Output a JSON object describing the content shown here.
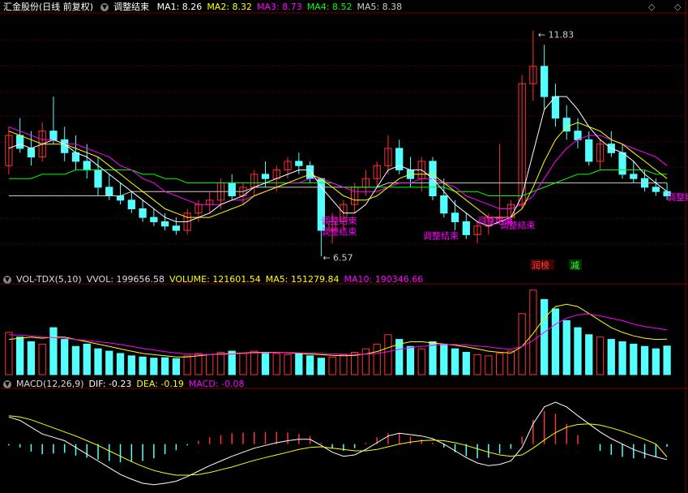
{
  "header": {
    "stock_name": "汇金股份(日线 前复权)",
    "indicator_name": "调整结束",
    "ma": [
      {
        "label": "MA1: 8.26",
        "color": "#ffffff"
      },
      {
        "label": "MA2: 8.32",
        "color": "#ffff00"
      },
      {
        "label": "MA3: 8.73",
        "color": "#ff00ff"
      },
      {
        "label": "MA4: 8.52",
        "color": "#00ff00"
      },
      {
        "label": "MA5: 8.38",
        "color": "#cccccc"
      }
    ],
    "nav_left": "◇",
    "nav_right": "◇"
  },
  "vol_header": {
    "name": "VOL-TDX(5,10)",
    "vvol": "VVOL: 199656.58",
    "volume": "VOLUME: 121601.54",
    "ma5": "MA5: 151279.84",
    "ma10": "MA10: 190346.66"
  },
  "macd_header": {
    "name": "MACD(12,26,9)",
    "dif": "DIF: -0.23",
    "dea": "DEA: -0.19",
    "macd": "MACD: -0.08"
  },
  "colors": {
    "up": "#ff3232",
    "down": "#54ffff",
    "ma1": "#ffffff",
    "ma2": "#ffff00",
    "ma3": "#ff00ff",
    "ma4": "#00ff00",
    "ma5": "#cccccc",
    "signal": "#ff00ff",
    "grid": "#7a0000"
  },
  "chart_data": {
    "type": "candlestick",
    "high_label": "11.83",
    "low_label": "6.57",
    "signals": [
      "调整结束",
      "调整结束",
      "调整结束",
      "调整结束",
      "调整结束",
      "调整结束"
    ],
    "tags": [
      "润榜",
      "减"
    ],
    "price": {
      "ylim": [
        6.3,
        12.2
      ],
      "candles": [
        {
          "o": 8.7,
          "h": 9.6,
          "l": 8.5,
          "c": 9.4
        },
        {
          "o": 9.4,
          "h": 9.8,
          "l": 9.0,
          "c": 9.1
        },
        {
          "o": 9.1,
          "h": 9.5,
          "l": 8.7,
          "c": 8.9
        },
        {
          "o": 8.9,
          "h": 9.7,
          "l": 8.8,
          "c": 9.5
        },
        {
          "o": 9.5,
          "h": 10.3,
          "l": 9.2,
          "c": 9.3
        },
        {
          "o": 9.3,
          "h": 9.6,
          "l": 8.8,
          "c": 9.0
        },
        {
          "o": 9.0,
          "h": 9.4,
          "l": 8.6,
          "c": 8.8
        },
        {
          "o": 8.8,
          "h": 9.2,
          "l": 8.4,
          "c": 8.6
        },
        {
          "o": 8.6,
          "h": 8.9,
          "l": 8.0,
          "c": 8.2
        },
        {
          "o": 8.2,
          "h": 8.5,
          "l": 7.9,
          "c": 8.0
        },
        {
          "o": 8.0,
          "h": 8.3,
          "l": 7.8,
          "c": 7.9
        },
        {
          "o": 7.9,
          "h": 8.1,
          "l": 7.6,
          "c": 7.7
        },
        {
          "o": 7.7,
          "h": 7.9,
          "l": 7.4,
          "c": 7.5
        },
        {
          "o": 7.5,
          "h": 7.7,
          "l": 7.3,
          "c": 7.4
        },
        {
          "o": 7.4,
          "h": 7.6,
          "l": 7.2,
          "c": 7.3
        },
        {
          "o": 7.3,
          "h": 7.5,
          "l": 7.1,
          "c": 7.2
        },
        {
          "o": 7.2,
          "h": 7.7,
          "l": 7.1,
          "c": 7.6
        },
        {
          "o": 7.6,
          "h": 7.9,
          "l": 7.4,
          "c": 7.8
        },
        {
          "o": 7.8,
          "h": 8.1,
          "l": 7.6,
          "c": 7.9
        },
        {
          "o": 7.9,
          "h": 8.4,
          "l": 7.7,
          "c": 8.3
        },
        {
          "o": 8.3,
          "h": 8.5,
          "l": 7.9,
          "c": 8.0
        },
        {
          "o": 8.0,
          "h": 8.3,
          "l": 7.8,
          "c": 8.2
        },
        {
          "o": 8.2,
          "h": 8.6,
          "l": 8.0,
          "c": 8.5
        },
        {
          "o": 8.5,
          "h": 8.8,
          "l": 8.2,
          "c": 8.4
        },
        {
          "o": 8.4,
          "h": 8.7,
          "l": 8.1,
          "c": 8.6
        },
        {
          "o": 8.6,
          "h": 8.9,
          "l": 8.4,
          "c": 8.8
        },
        {
          "o": 8.8,
          "h": 9.0,
          "l": 8.5,
          "c": 8.7
        },
        {
          "o": 8.7,
          "h": 8.8,
          "l": 8.3,
          "c": 8.4
        },
        {
          "o": 8.4,
          "h": 7.5,
          "l": 6.6,
          "c": 7.2
        },
        {
          "o": 7.2,
          "h": 7.6,
          "l": 6.9,
          "c": 7.4
        },
        {
          "o": 7.4,
          "h": 7.9,
          "l": 7.2,
          "c": 7.8
        },
        {
          "o": 7.8,
          "h": 8.3,
          "l": 7.6,
          "c": 8.2
        },
        {
          "o": 8.2,
          "h": 8.6,
          "l": 8.0,
          "c": 8.4
        },
        {
          "o": 8.4,
          "h": 8.8,
          "l": 8.2,
          "c": 8.7
        },
        {
          "o": 8.7,
          "h": 9.4,
          "l": 8.5,
          "c": 9.1
        },
        {
          "o": 9.1,
          "h": 9.3,
          "l": 8.5,
          "c": 8.6
        },
        {
          "o": 8.6,
          "h": 8.9,
          "l": 8.2,
          "c": 8.4
        },
        {
          "o": 8.4,
          "h": 8.9,
          "l": 8.1,
          "c": 8.8
        },
        {
          "o": 8.8,
          "h": 8.9,
          "l": 7.9,
          "c": 8.0
        },
        {
          "o": 8.0,
          "h": 8.4,
          "l": 7.5,
          "c": 7.6
        },
        {
          "o": 7.6,
          "h": 7.9,
          "l": 7.2,
          "c": 7.4
        },
        {
          "o": 7.4,
          "h": 7.6,
          "l": 7.0,
          "c": 7.1
        },
        {
          "o": 7.1,
          "h": 7.4,
          "l": 6.9,
          "c": 7.3
        },
        {
          "o": 7.3,
          "h": 7.6,
          "l": 7.1,
          "c": 7.5
        },
        {
          "o": 7.5,
          "h": 9.2,
          "l": 7.4,
          "c": 7.5
        },
        {
          "o": 7.5,
          "h": 7.9,
          "l": 7.3,
          "c": 7.8
        },
        {
          "o": 7.8,
          "h": 10.8,
          "l": 7.7,
          "c": 10.6
        },
        {
          "o": 10.6,
          "h": 11.83,
          "l": 10.2,
          "c": 11.0
        },
        {
          "o": 11.0,
          "h": 11.5,
          "l": 10.0,
          "c": 10.3
        },
        {
          "o": 10.3,
          "h": 10.6,
          "l": 9.6,
          "c": 9.8
        },
        {
          "o": 9.8,
          "h": 10.1,
          "l": 9.3,
          "c": 9.5
        },
        {
          "o": 9.5,
          "h": 9.8,
          "l": 9.1,
          "c": 9.3
        },
        {
          "o": 9.3,
          "h": 9.5,
          "l": 8.7,
          "c": 8.8
        },
        {
          "o": 8.8,
          "h": 9.3,
          "l": 8.6,
          "c": 9.2
        },
        {
          "o": 9.2,
          "h": 9.5,
          "l": 8.9,
          "c": 9.0
        },
        {
          "o": 9.0,
          "h": 9.2,
          "l": 8.4,
          "c": 8.5
        },
        {
          "o": 8.5,
          "h": 8.8,
          "l": 8.3,
          "c": 8.4
        },
        {
          "o": 8.4,
          "h": 8.6,
          "l": 8.1,
          "c": 8.2
        },
        {
          "o": 8.2,
          "h": 8.4,
          "l": 8.0,
          "c": 8.1
        },
        {
          "o": 8.1,
          "h": 8.3,
          "l": 7.9,
          "c": 8.0
        }
      ],
      "ma1": [
        9.1,
        9.2,
        9.1,
        9.2,
        9.3,
        9.2,
        9.0,
        8.9,
        8.7,
        8.5,
        8.3,
        8.1,
        7.9,
        7.7,
        7.5,
        7.4,
        7.4,
        7.5,
        7.6,
        7.8,
        7.9,
        8.0,
        8.2,
        8.3,
        8.4,
        8.5,
        8.6,
        8.6,
        8.2,
        7.9,
        7.6,
        7.6,
        7.8,
        8.2,
        8.6,
        8.7,
        8.6,
        8.6,
        8.4,
        8.1,
        7.8,
        7.6,
        7.4,
        7.3,
        7.4,
        7.5,
        8.0,
        9.0,
        10.0,
        10.3,
        10.3,
        10.0,
        9.6,
        9.3,
        9.1,
        9.0,
        8.8,
        8.5,
        8.3,
        8.1
      ],
      "ma2": [
        9.5,
        9.4,
        9.3,
        9.2,
        9.2,
        9.2,
        9.1,
        9.0,
        8.9,
        8.7,
        8.5,
        8.3,
        8.1,
        7.9,
        7.7,
        7.6,
        7.5,
        7.5,
        7.5,
        7.6,
        7.7,
        7.8,
        8.0,
        8.1,
        8.2,
        8.3,
        8.4,
        8.5,
        8.4,
        8.2,
        8.0,
        7.9,
        7.9,
        8.0,
        8.2,
        8.4,
        8.5,
        8.5,
        8.5,
        8.3,
        8.1,
        7.9,
        7.7,
        7.5,
        7.5,
        7.5,
        7.7,
        8.2,
        8.8,
        9.3,
        9.6,
        9.7,
        9.6,
        9.5,
        9.3,
        9.2,
        9.0,
        8.8,
        8.6,
        8.4
      ],
      "ma3": [
        9.6,
        9.5,
        9.4,
        9.3,
        9.3,
        9.2,
        9.2,
        9.1,
        9.0,
        8.9,
        8.7,
        8.6,
        8.4,
        8.3,
        8.1,
        8.0,
        7.9,
        7.8,
        7.8,
        7.8,
        7.9,
        7.9,
        8.0,
        8.1,
        8.2,
        8.3,
        8.3,
        8.4,
        8.4,
        8.3,
        8.2,
        8.1,
        8.1,
        8.1,
        8.2,
        8.3,
        8.3,
        8.4,
        8.4,
        8.3,
        8.2,
        8.0,
        7.9,
        7.8,
        7.7,
        7.7,
        7.8,
        8.0,
        8.4,
        8.8,
        9.1,
        9.3,
        9.4,
        9.4,
        9.3,
        9.2,
        9.1,
        9.0,
        8.9,
        8.7
      ],
      "ma4": [
        8.4,
        8.4,
        8.4,
        8.5,
        8.5,
        8.5,
        8.6,
        8.6,
        8.6,
        8.6,
        8.6,
        8.6,
        8.5,
        8.5,
        8.4,
        8.4,
        8.3,
        8.3,
        8.3,
        8.3,
        8.3,
        8.3,
        8.3,
        8.3,
        8.3,
        8.3,
        8.3,
        8.3,
        8.3,
        8.3,
        8.2,
        8.2,
        8.2,
        8.2,
        8.2,
        8.2,
        8.2,
        8.2,
        8.2,
        8.2,
        8.1,
        8.1,
        8.1,
        8.0,
        8.0,
        8.0,
        8.0,
        8.1,
        8.2,
        8.3,
        8.4,
        8.5,
        8.5,
        8.6,
        8.6,
        8.6,
        8.6,
        8.6,
        8.5,
        8.5
      ],
      "ma5": [
        8.0,
        8.0,
        8.0,
        8.0,
        8.0,
        8.0,
        8.0,
        8.0,
        8.0,
        8.0,
        8.0,
        8.1,
        8.1,
        8.1,
        8.1,
        8.1,
        8.1,
        8.1,
        8.1,
        8.1,
        8.1,
        8.1,
        8.2,
        8.2,
        8.2,
        8.2,
        8.2,
        8.2,
        8.2,
        8.2,
        8.2,
        8.2,
        8.2,
        8.2,
        8.3,
        8.3,
        8.3,
        8.3,
        8.3,
        8.3,
        8.3,
        8.3,
        8.3,
        8.3,
        8.3,
        8.3,
        8.3,
        8.3,
        8.3,
        8.3,
        8.3,
        8.3,
        8.3,
        8.3,
        8.3,
        8.3,
        8.3,
        8.3,
        8.3,
        8.3
      ]
    },
    "volume": {
      "ylim": [
        0,
        380000
      ],
      "bars": [
        180000,
        160000,
        140000,
        130000,
        200000,
        150000,
        120000,
        130000,
        110000,
        100000,
        90000,
        80000,
        75000,
        70000,
        72000,
        68000,
        80000,
        90000,
        85000,
        95000,
        100000,
        90000,
        100000,
        95000,
        90000,
        85000,
        88000,
        80000,
        70000,
        75000,
        85000,
        95000,
        110000,
        130000,
        170000,
        150000,
        120000,
        110000,
        140000,
        130000,
        110000,
        95000,
        85000,
        80000,
        90000,
        100000,
        260000,
        360000,
        320000,
        280000,
        230000,
        200000,
        170000,
        160000,
        150000,
        140000,
        130000,
        120000,
        110000,
        121601.54
      ],
      "ma5": [
        150000,
        155000,
        160000,
        155000,
        160000,
        160000,
        150000,
        140000,
        130000,
        120000,
        110000,
        100000,
        90000,
        85000,
        80000,
        75000,
        75000,
        80000,
        85000,
        88000,
        90000,
        92000,
        94000,
        95000,
        95000,
        93000,
        90000,
        87000,
        85000,
        82000,
        80000,
        82000,
        88000,
        98000,
        115000,
        130000,
        140000,
        140000,
        135000,
        130000,
        125000,
        118000,
        110000,
        100000,
        95000,
        92000,
        120000,
        175000,
        240000,
        290000,
        300000,
        290000,
        260000,
        230000,
        200000,
        180000,
        165000,
        155000,
        150000,
        151279.84
      ],
      "ma10": [
        170000,
        168000,
        165000,
        160000,
        158000,
        155000,
        150000,
        145000,
        140000,
        135000,
        128000,
        120000,
        112000,
        105000,
        98000,
        92000,
        88000,
        86000,
        85000,
        86000,
        88000,
        90000,
        92000,
        93000,
        94000,
        94000,
        93000,
        92000,
        90000,
        88000,
        87000,
        86000,
        87000,
        90000,
        98000,
        108000,
        115000,
        120000,
        125000,
        128000,
        128000,
        126000,
        122000,
        118000,
        112000,
        108000,
        120000,
        145000,
        180000,
        215000,
        240000,
        255000,
        258000,
        250000,
        240000,
        230000,
        215000,
        205000,
        198000,
        190346.66
      ]
    },
    "macd": {
      "ylim": [
        -0.7,
        0.8
      ],
      "dif": [
        0.4,
        0.35,
        0.25,
        0.15,
        0.1,
        0.05,
        -0.05,
        -0.15,
        -0.25,
        -0.35,
        -0.45,
        -0.52,
        -0.58,
        -0.6,
        -0.58,
        -0.55,
        -0.48,
        -0.4,
        -0.32,
        -0.25,
        -0.18,
        -0.12,
        -0.06,
        -0.02,
        0.02,
        0.05,
        0.07,
        0.07,
        -0.02,
        -0.12,
        -0.18,
        -0.16,
        -0.08,
        0.02,
        0.12,
        0.16,
        0.14,
        0.12,
        0.08,
        0.0,
        -0.1,
        -0.2,
        -0.28,
        -0.32,
        -0.3,
        -0.25,
        -0.05,
        0.3,
        0.55,
        0.62,
        0.55,
        0.42,
        0.3,
        0.18,
        0.08,
        0.0,
        -0.08,
        -0.14,
        -0.19,
        -0.23
      ],
      "dea": [
        0.42,
        0.4,
        0.36,
        0.3,
        0.24,
        0.18,
        0.12,
        0.05,
        -0.02,
        -0.1,
        -0.18,
        -0.26,
        -0.33,
        -0.39,
        -0.43,
        -0.46,
        -0.46,
        -0.45,
        -0.42,
        -0.38,
        -0.34,
        -0.29,
        -0.24,
        -0.2,
        -0.16,
        -0.12,
        -0.08,
        -0.05,
        -0.04,
        -0.06,
        -0.08,
        -0.1,
        -0.1,
        -0.08,
        -0.04,
        0.0,
        0.03,
        0.05,
        0.06,
        0.05,
        0.02,
        -0.02,
        -0.07,
        -0.12,
        -0.16,
        -0.18,
        -0.16,
        -0.06,
        0.06,
        0.17,
        0.25,
        0.29,
        0.3,
        0.28,
        0.24,
        0.19,
        0.13,
        0.07,
        0.0,
        -0.19
      ],
      "macd": [
        -0.04,
        -0.1,
        -0.22,
        -0.3,
        -0.28,
        -0.26,
        -0.34,
        -0.4,
        -0.46,
        -0.5,
        -0.54,
        -0.52,
        -0.5,
        -0.42,
        -0.3,
        -0.18,
        -0.04,
        0.1,
        0.2,
        0.26,
        0.32,
        0.34,
        0.36,
        0.36,
        0.36,
        0.34,
        0.3,
        0.24,
        0.04,
        -0.12,
        -0.2,
        -0.12,
        0.04,
        0.2,
        0.32,
        0.32,
        0.22,
        0.14,
        0.04,
        -0.1,
        -0.24,
        -0.36,
        -0.42,
        -0.4,
        -0.28,
        -0.14,
        0.22,
        0.72,
        0.98,
        0.9,
        0.6,
        0.26,
        0.0,
        -0.2,
        -0.32,
        -0.38,
        -0.42,
        -0.42,
        -0.38,
        -0.08
      ]
    }
  }
}
